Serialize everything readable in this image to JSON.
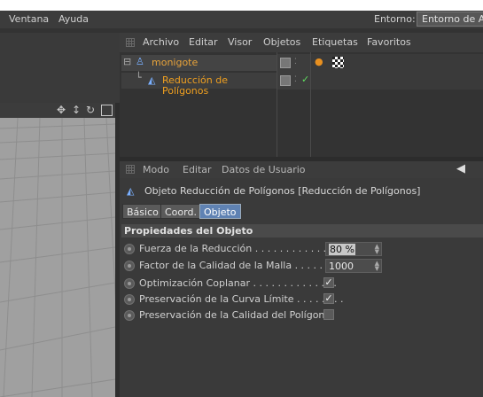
{
  "menubar": {
    "items": [
      {
        "label": "Ventana"
      },
      {
        "label": "Ayuda"
      }
    ],
    "environment_label": "Entorno:",
    "environment_value": "Entorno de A"
  },
  "object_manager": {
    "menu": [
      "Archivo",
      "Editar",
      "Visor",
      "Objetos",
      "Etiquetas",
      "Favoritos"
    ],
    "objects": [
      {
        "name": "monigote",
        "color": "#e8a33a"
      },
      {
        "name": "Reducción de Polígonos",
        "color": "#f0a020"
      }
    ]
  },
  "attribute_manager": {
    "menu": [
      "Modo",
      "Editar",
      "Datos de Usuario"
    ],
    "title": "Objeto Reducción de Polígonos  [Reducción de Polígonos]",
    "tabs": [
      {
        "label": "Básico",
        "active": false
      },
      {
        "label": "Coord.",
        "active": false
      },
      {
        "label": "Objeto",
        "active": true
      }
    ],
    "section": "Propiedades del Objeto",
    "properties": [
      {
        "label": "Fuerza de la Reducción . . . . . . . . . . . . . .",
        "value": "80 %"
      },
      {
        "label": "Factor de la Calidad de la Malla . . . . . . .",
        "value": "1000"
      },
      {
        "label": "Optimización Coplanar . . . . . . . . . . . . . .",
        "checked": true
      },
      {
        "label": "Preservación de la Curva Límite . . . . . . . .",
        "checked": true
      },
      {
        "label": "Preservación de la Calidad del Polígono",
        "checked": false
      }
    ]
  },
  "colors": {
    "accent_tab": "#5f82b3",
    "object_name": "#f0a020",
    "viewport_bg": "#a0a0a0"
  }
}
